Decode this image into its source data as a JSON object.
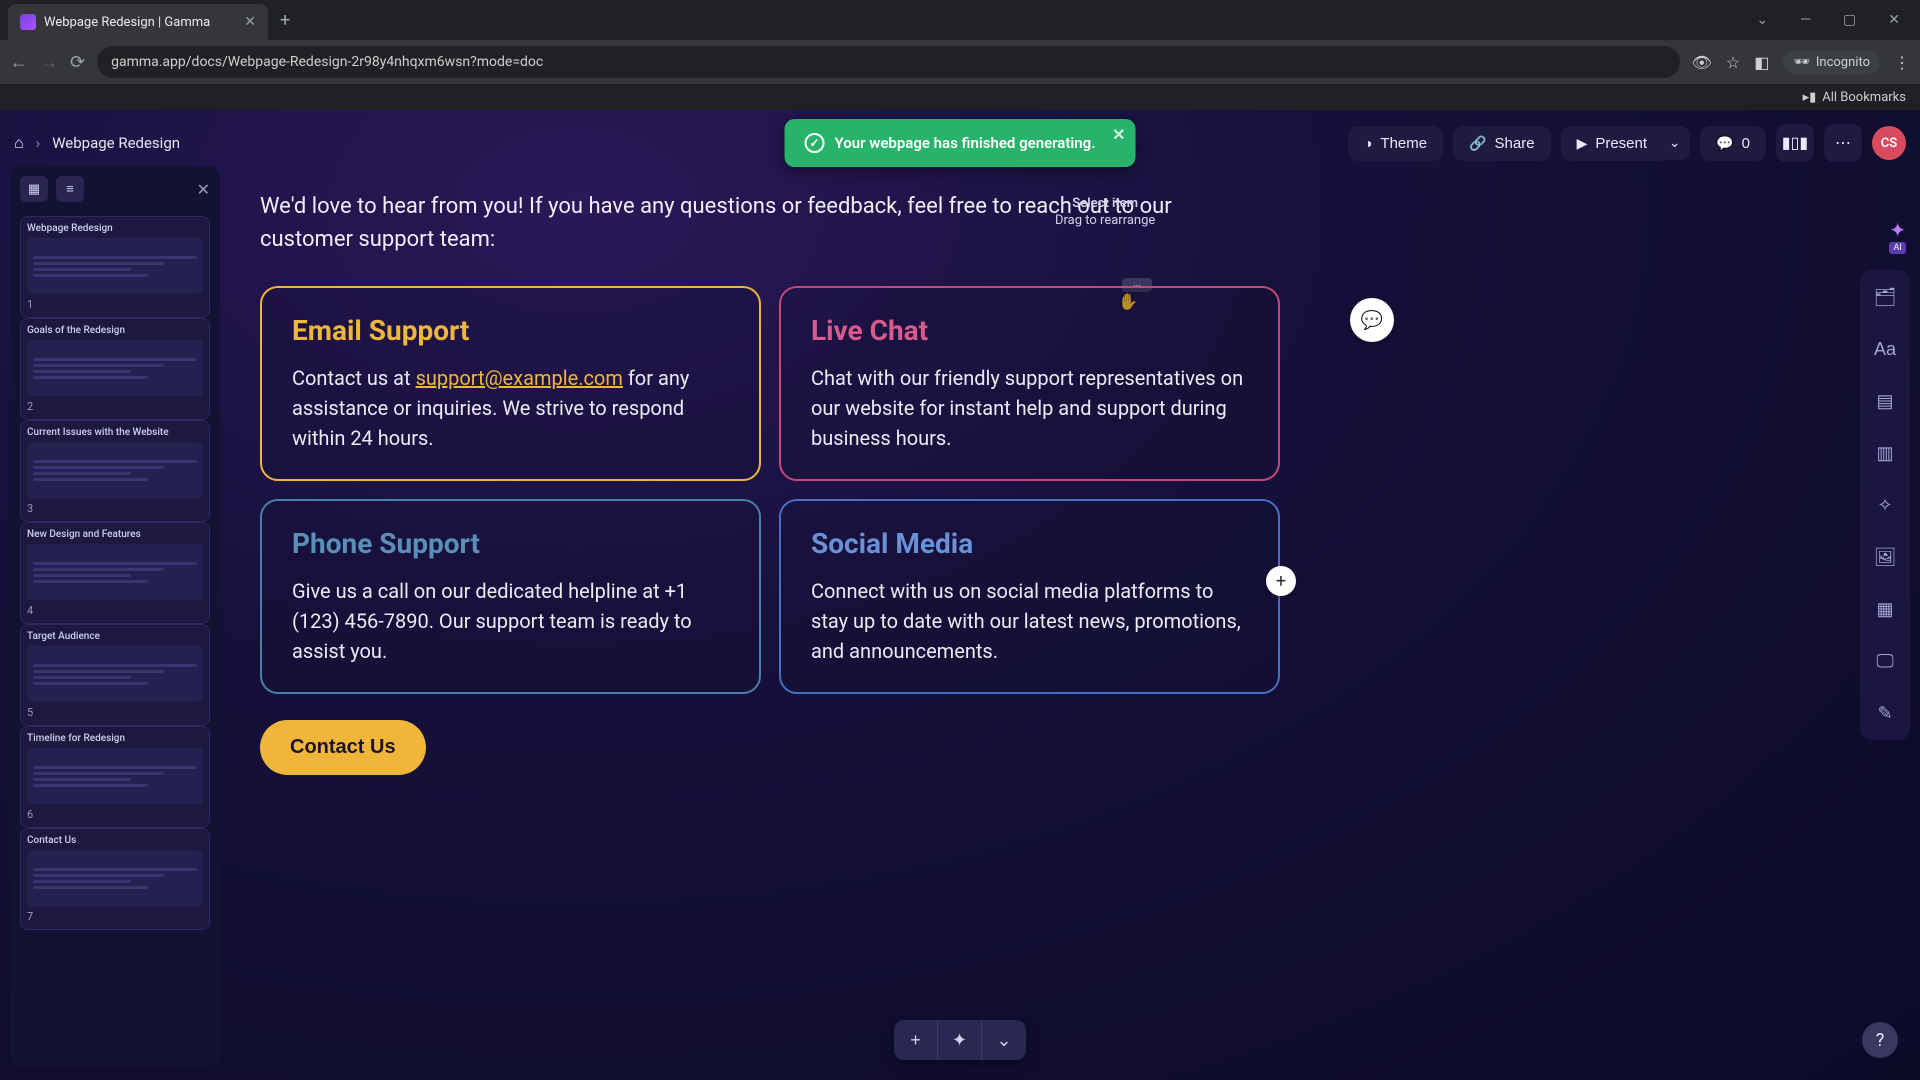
{
  "browser": {
    "tab_title": "Webpage Redesign | Gamma",
    "url": "gamma.app/docs/Webpage-Redesign-2r98y4nhqxm6wsn?mode=doc",
    "incognito_label": "Incognito",
    "all_bookmarks": "All Bookmarks"
  },
  "breadcrumb": {
    "doc_title": "Webpage Redesign"
  },
  "toast": {
    "message": "Your webpage has finished generating."
  },
  "actions": {
    "theme": "Theme",
    "share": "Share",
    "present": "Present",
    "comment_count": "0",
    "avatar_initials": "CS"
  },
  "thumbnails": [
    {
      "num": "1",
      "title": "Webpage Redesign"
    },
    {
      "num": "2",
      "title": "Goals of the Redesign"
    },
    {
      "num": "3",
      "title": "Current Issues with the Website"
    },
    {
      "num": "4",
      "title": "New Design and Features"
    },
    {
      "num": "5",
      "title": "Target Audience"
    },
    {
      "num": "6",
      "title": "Timeline for Redesign"
    },
    {
      "num": "7",
      "title": "Contact Us"
    }
  ],
  "content": {
    "intro": "We'd love to hear from you! If you have any questions or feedback, feel free to reach out to our customer support team:",
    "cards": [
      {
        "title": "Email Support",
        "body_pre": "Contact us at ",
        "link": "support@example.com",
        "body_post": " for any assistance or inquiries. We strive to respond within 24 hours."
      },
      {
        "title": "Live Chat",
        "body": "Chat with our friendly support representatives on our website for instant help and support during business hours."
      },
      {
        "title": "Phone Support",
        "body": "Give us a call on our dedicated helpline at +1 (123) 456-7890. Our support team is ready to assist you."
      },
      {
        "title": "Social Media",
        "body": "Connect with us on social media platforms to stay up to date with our latest news, promotions, and announcements."
      }
    ],
    "cta": "Contact Us"
  },
  "hints": {
    "select": "Select item",
    "drag": "Drag to rearrange"
  },
  "ai_label": "AI"
}
